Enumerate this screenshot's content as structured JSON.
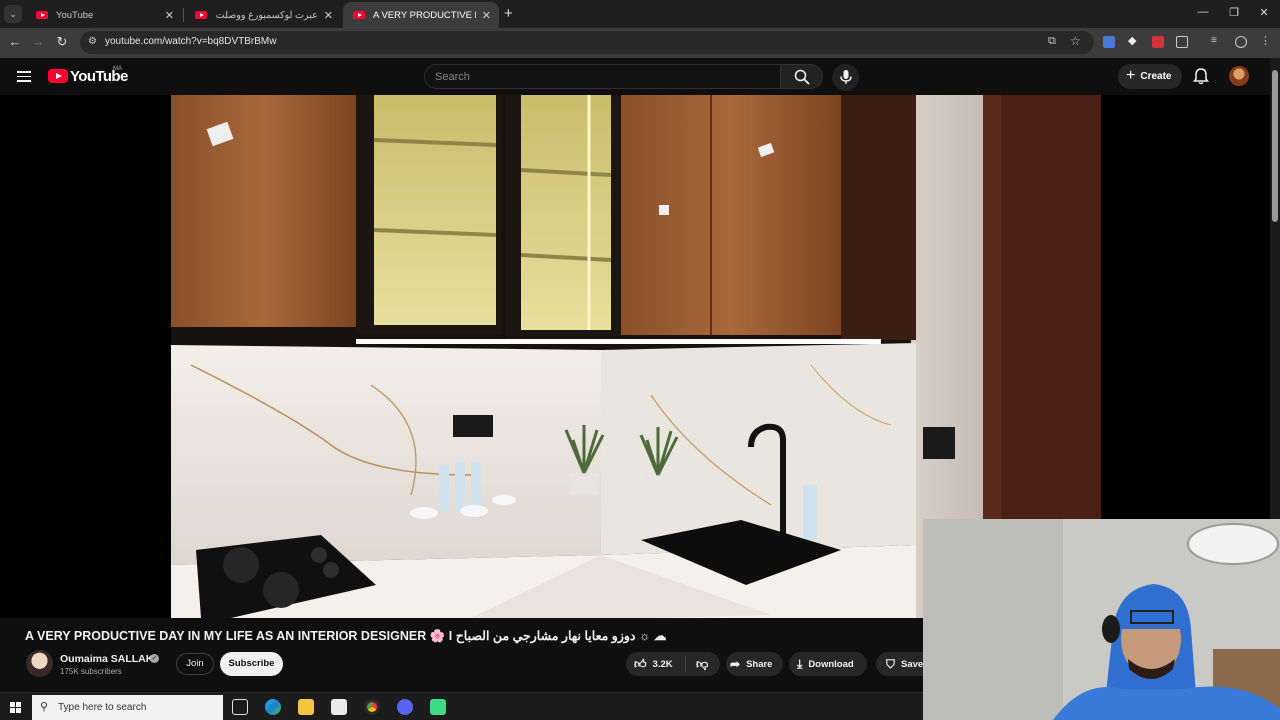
{
  "browser": {
    "tabs": [
      {
        "title": "YouTube",
        "active": false
      },
      {
        "title": "عبرت لوكسمبورغ ووصلت صواح...",
        "active": false
      },
      {
        "title": "A VERY PRODUCTIVE DAY IN M",
        "active": true
      }
    ],
    "new_tab": "+",
    "url": "youtube.com/watch?v=bq8DVTBrBMw"
  },
  "youtube": {
    "logo_text": "YouTube",
    "country": "MA",
    "search_placeholder": "Search",
    "create_label": "Create",
    "video": {
      "title": "A VERY PRODUCTIVE DAY IN MY LIFE AS AN INTERIOR DESIGNER 🌸 I دوزو معايا نهار مشارجي من الصباح ☼ ☁",
      "channel_name": "Oumaima SALLAK",
      "subscribers": "175K subscribers",
      "join_label": "Join",
      "subscribe_label": "Subscribe",
      "likes": "3.2K",
      "share_label": "Share",
      "download_label": "Download",
      "save_label": "Save"
    }
  },
  "taskbar": {
    "search_placeholder": "Type here to search"
  },
  "colors": {
    "youtube_red": "#ff0033",
    "background": "#0f0f0f"
  }
}
